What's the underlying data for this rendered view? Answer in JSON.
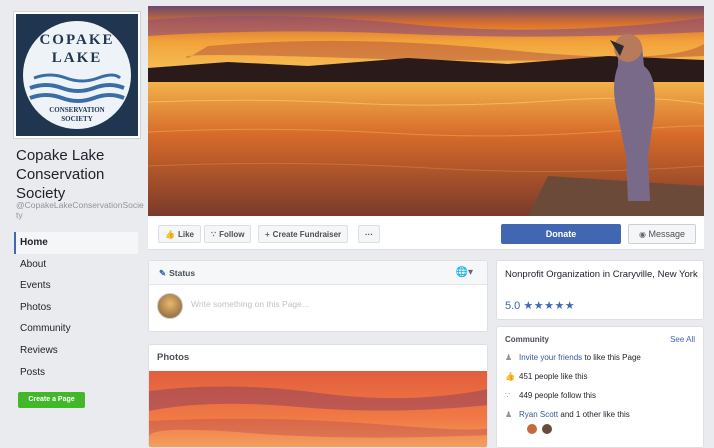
{
  "page": {
    "name": "Copake Lake Conservation Society",
    "handle": "@CopakeLakeConservationSociety"
  },
  "logo": {
    "line1": "COPAKE",
    "line2": "LAKE",
    "line3": "CONSERVATION",
    "line4": "SOCIETY"
  },
  "nav": {
    "items": [
      {
        "label": "Home"
      },
      {
        "label": "About"
      },
      {
        "label": "Events"
      },
      {
        "label": "Photos"
      },
      {
        "label": "Community"
      },
      {
        "label": "Reviews"
      },
      {
        "label": "Posts"
      }
    ],
    "create_page": "Create a Page"
  },
  "actions": {
    "like": "Like",
    "follow": "Follow",
    "fundraiser": "Create Fundraiser",
    "more": "···",
    "donate": "Donate",
    "message": "Message"
  },
  "status": {
    "header": "Status",
    "placeholder": "Write something on this Page..."
  },
  "photos": {
    "title": "Photos"
  },
  "info": {
    "category": "Nonprofit Organization in Craryville, New York",
    "rating_value": "5.0",
    "rating_stars": "★★★★★"
  },
  "community": {
    "title": "Community",
    "see_all": "See All",
    "invite_link": "Invite your friends",
    "invite_rest": " to like this Page",
    "likes": "451 people like this",
    "follows": "449 people follow this",
    "friend_name": "Ryan Scott",
    "friend_rest": " and 1 other like this"
  },
  "icons": {
    "like": "thumbs-up-icon",
    "follow": "rss-icon",
    "fundraiser": "plus-icon",
    "status": "pencil-icon",
    "audience": "globe-icon",
    "message": "chat-bubble-icon"
  },
  "colors": {
    "brand_blue": "#4267b2",
    "create_green": "#42b72a",
    "link_blue": "#365899",
    "background": "#e9ebee"
  }
}
